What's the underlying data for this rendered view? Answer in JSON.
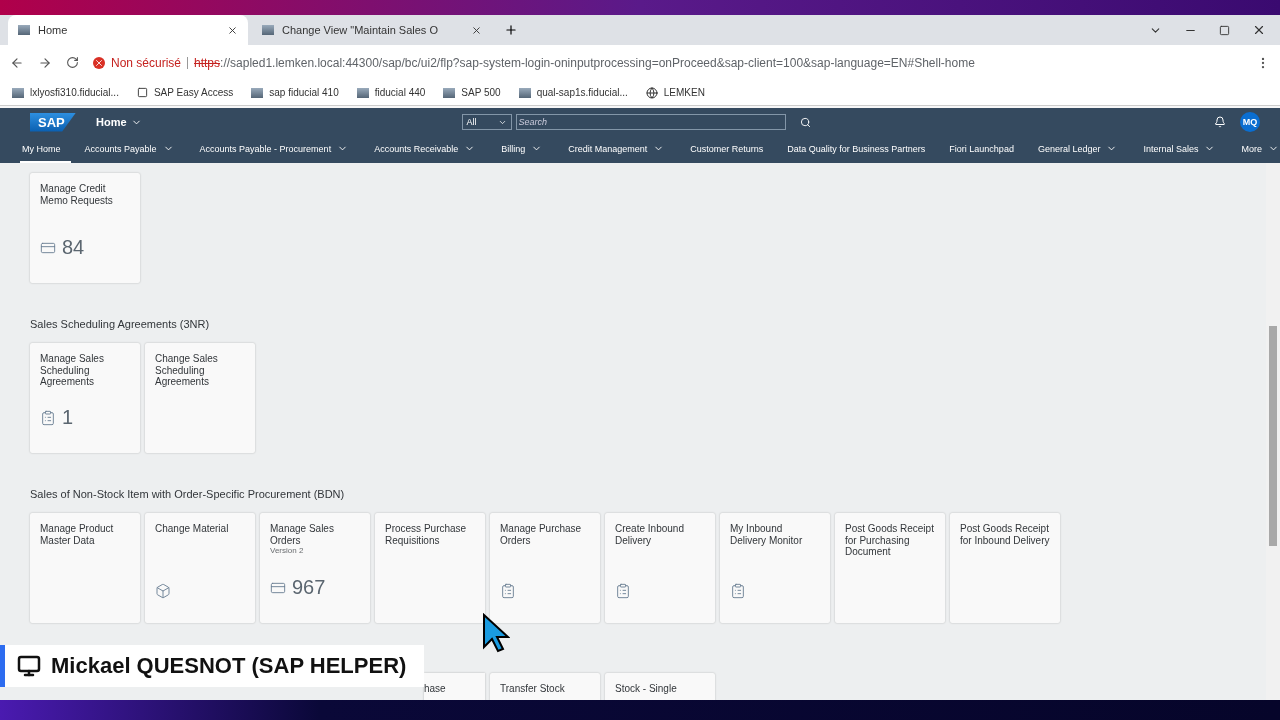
{
  "browser": {
    "tabs": [
      {
        "title": "Home",
        "selected": true
      },
      {
        "title": "Change View \"Maintain Sales O",
        "selected": false
      }
    ],
    "security": "Non sécurisé",
    "url_scheme": "https",
    "url": "://sapled1.lemken.local:44300/sap/bc/ui2/flp?sap-system-login-oninputprocessing=onProceed&sap-client=100&sap-language=EN#Shell-home",
    "bookmarks": [
      {
        "label": "lxlyosfi310.fiducial...",
        "kind": "page"
      },
      {
        "label": "SAP Easy Access",
        "kind": "app"
      },
      {
        "label": "sap fiducial 410",
        "kind": "page"
      },
      {
        "label": "fiducial 440",
        "kind": "page"
      },
      {
        "label": "SAP 500",
        "kind": "page"
      },
      {
        "label": "qual-sap1s.fiducial...",
        "kind": "page"
      },
      {
        "label": "LEMKEN",
        "kind": "globe"
      }
    ]
  },
  "shell": {
    "logo": "SAP",
    "home": "Home",
    "search_scope": "All",
    "search_placeholder": "Search",
    "avatar": "MQ"
  },
  "nav": [
    {
      "label": "My Home",
      "selected": true,
      "dropdown": false
    },
    {
      "label": "Accounts Payable",
      "selected": false,
      "dropdown": true
    },
    {
      "label": "Accounts Payable - Procurement",
      "selected": false,
      "dropdown": true
    },
    {
      "label": "Accounts Receivable",
      "selected": false,
      "dropdown": true
    },
    {
      "label": "Billing",
      "selected": false,
      "dropdown": true
    },
    {
      "label": "Credit Management",
      "selected": false,
      "dropdown": true
    },
    {
      "label": "Customer Returns",
      "selected": false,
      "dropdown": false
    },
    {
      "label": "Data Quality for Business Partners",
      "selected": false,
      "dropdown": false
    },
    {
      "label": "Fiori Launchpad",
      "selected": false,
      "dropdown": false
    },
    {
      "label": "General Ledger",
      "selected": false,
      "dropdown": true
    },
    {
      "label": "Internal Sales",
      "selected": false,
      "dropdown": true
    },
    {
      "label": "More",
      "selected": false,
      "dropdown": true
    }
  ],
  "groups": [
    {
      "tiles": [
        {
          "title": "Manage Credit Memo Requests",
          "kind": "counter",
          "count": "84"
        }
      ]
    },
    {
      "title": "Sales Scheduling Agreements (3NR)",
      "tiles": [
        {
          "title": "Manage Sales Scheduling Agreements",
          "kind": "counter",
          "count": "1"
        },
        {
          "title": "Change Sales Scheduling Agreements",
          "kind": "text"
        }
      ]
    },
    {
      "title": "Sales of Non-Stock Item with Order-Specific Procurement (BDN)",
      "tiles": [
        {
          "title": "Manage Product Master Data",
          "kind": "text"
        },
        {
          "title": "Change Material",
          "kind": "launch"
        },
        {
          "title": "Manage Sales Orders",
          "subtitle": "Version 2",
          "kind": "counter",
          "count": "967"
        },
        {
          "title": "Process Purchase Requisitions",
          "kind": "text"
        },
        {
          "title": "Manage Purchase Orders",
          "kind": "launch"
        },
        {
          "title": "Create Inbound Delivery",
          "kind": "launch"
        },
        {
          "title": "My Inbound Delivery Monitor",
          "kind": "launch"
        },
        {
          "title": "Post Goods Receipt for Purchasing Document",
          "kind": "text"
        },
        {
          "title": "Post Goods Receipt for Inbound Delivery",
          "kind": "text"
        }
      ]
    },
    {
      "tiles": [
        {
          "kind": "hidden"
        },
        {
          "kind": "hidden"
        },
        {
          "kind": "hidden"
        },
        {
          "title": "hase",
          "kind": "partial"
        },
        {
          "title": "Transfer Stock",
          "kind": "text"
        },
        {
          "title": "Stock - Single",
          "kind": "text"
        }
      ]
    }
  ],
  "caption": "Mickael QUESNOT (SAP HELPER)"
}
